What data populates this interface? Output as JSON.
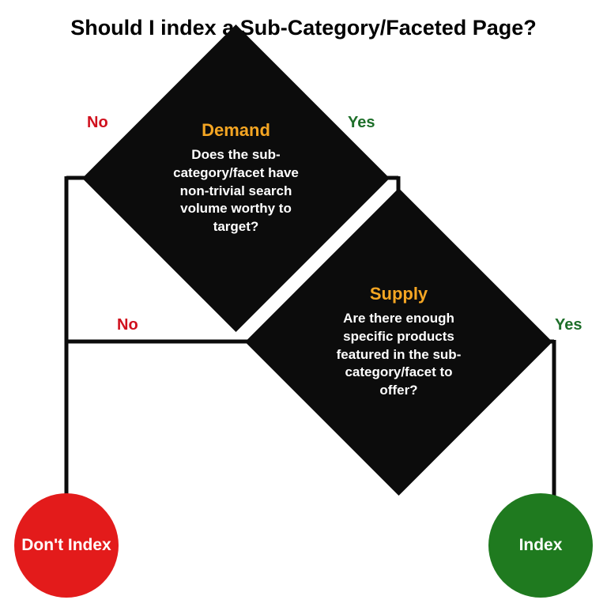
{
  "title": "Should I index a Sub-Category/Faceted Page?",
  "nodes": {
    "demand": {
      "heading": "Demand",
      "body": "Does the sub-category/facet have non-trivial search volume worthy to target?"
    },
    "supply": {
      "heading": "Supply",
      "body": "Are there enough specific products featured in the sub-category/facet to offer?"
    },
    "dontIndex": {
      "label": "Don't Index"
    },
    "index": {
      "label": "Index"
    }
  },
  "edges": {
    "demand_no": "No",
    "demand_yes": "Yes",
    "supply_no": "No",
    "supply_yes": "Yes"
  },
  "colors": {
    "diamond": "#0c0c0c",
    "heading": "#f5a623",
    "no_circle": "#e31b1b",
    "yes_circle": "#1f7a1f",
    "no_text": "#d0101d",
    "yes_text": "#1e6f2a"
  }
}
